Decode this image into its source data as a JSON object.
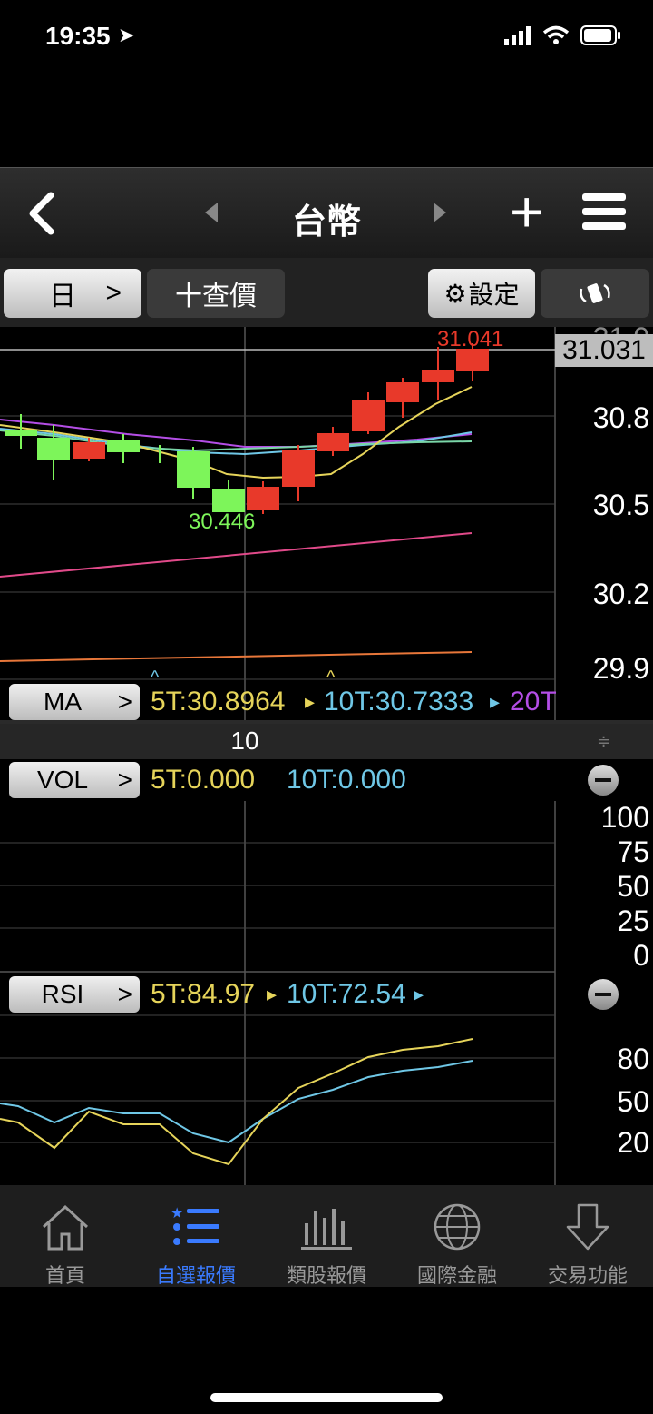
{
  "status": {
    "time": "19:35"
  },
  "nav": {
    "title": "台幣"
  },
  "toolbar": {
    "period": "日",
    "query": "十查價",
    "settings": "設定"
  },
  "chart": {
    "price_axis": [
      "31.0",
      "30.8",
      "30.5",
      "30.2",
      "29.9"
    ],
    "last_price": "31.031",
    "high_label": "31.041",
    "low_label": "30.446",
    "colors": {
      "up": "#e8392a",
      "down": "#7df55a",
      "ma5": "#e6d45a",
      "ma10": "#6fc7e6",
      "ma20": "#b44ee6"
    }
  },
  "ma": {
    "name": "MA",
    "v5": "5T:30.8964",
    "v10": "10T:30.7333",
    "v20": "20T"
  },
  "divider": {
    "label": "10"
  },
  "vol": {
    "name": "VOL",
    "v5": "5T:0.000",
    "v10": "10T:0.000",
    "axis": [
      "100",
      "75",
      "50",
      "25",
      "0"
    ]
  },
  "rsi": {
    "name": "RSI",
    "v5": "5T:84.97",
    "v10": "10T:72.54",
    "axis": [
      "80",
      "50",
      "20"
    ]
  },
  "tabs": [
    {
      "label": "首頁",
      "icon": "home-icon"
    },
    {
      "label": "自選報價",
      "icon": "watchlist-icon"
    },
    {
      "label": "類股報價",
      "icon": "bar-chart-icon"
    },
    {
      "label": "國際金融",
      "icon": "globe-icon"
    },
    {
      "label": "交易功能",
      "icon": "trade-arrow-icon"
    }
  ]
}
